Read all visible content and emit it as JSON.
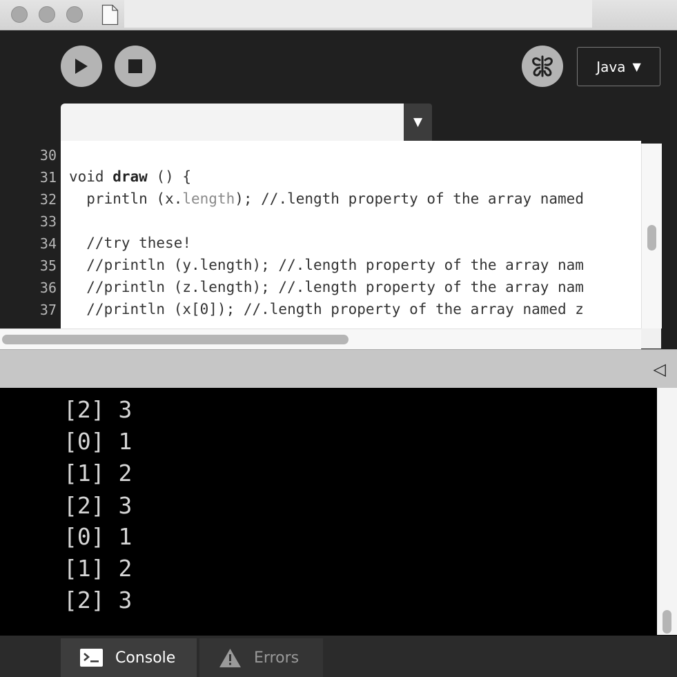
{
  "window": {
    "title": ""
  },
  "toolbar": {
    "run_icon": "play-icon",
    "stop_icon": "stop-icon",
    "debug_icon": "butterfly-icon",
    "mode_label": "Java",
    "mode_arrow": "▼"
  },
  "tabs": {
    "menu_arrow": "▼"
  },
  "editor": {
    "line_numbers": [
      "30",
      "31",
      "32",
      "33",
      "34",
      "35",
      "36",
      "37"
    ],
    "lines": [
      "",
      "",
      "  println (x.length); //.length property of the array named",
      "",
      "  //try these!",
      "  //println (y.length); //.length property of the array nam",
      "  //println (z.length); //.length property of the array nam",
      "  //println (x[0]); //.length property of the array named z"
    ],
    "line31_prefix": "void ",
    "line31_keyword": "draw",
    "line31_suffix": " () {",
    "line32_prefix": "  println (x.",
    "line32_dim": "length",
    "line32_suffix": "); //.length property of the array named"
  },
  "console": {
    "collapse_icon": "◁",
    "output": [
      "[2] 3",
      "[0] 1",
      "[1] 2",
      "[2] 3",
      "[0] 1",
      "[1] 2",
      "[2] 3"
    ]
  },
  "footer": {
    "console_label": "Console",
    "errors_label": "Errors"
  },
  "colors": {
    "toolbar_bg": "#202020",
    "editor_bg": "#ffffff",
    "console_bg": "#000000",
    "button_gray": "#b4b4b4"
  }
}
